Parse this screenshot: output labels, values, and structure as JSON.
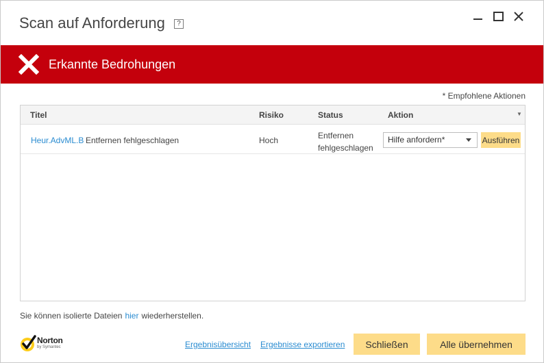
{
  "window": {
    "title": "Scan auf Anforderung",
    "help": "?"
  },
  "banner": {
    "text": "Erkannte Bedrohungen",
    "color": "#c4000c"
  },
  "note": "* Empfohlene Aktionen",
  "table": {
    "headers": {
      "title": "Titel",
      "risk": "Risiko",
      "status": "Status",
      "action": "Aktion"
    },
    "rows": [
      {
        "threat": "Heur.AdvML.B",
        "description": "Entfernen fehlgeschlagen",
        "risk": "Hoch",
        "status": "Entfernen fehlgeschlagen",
        "action": "Hilfe anfordern*",
        "run_label": "Ausführen"
      }
    ]
  },
  "restore": {
    "prefix": "Sie können isolierte Dateien",
    "link": "hier",
    "suffix": "wiederherstellen."
  },
  "footer": {
    "logo_name": "Norton",
    "logo_sub": "by Symantec",
    "summary_link": "Ergebnisübersicht",
    "export_link": "Ergebnisse exportieren",
    "close_label": "Schließen",
    "apply_label": "Alle übernehmen"
  },
  "colors": {
    "accent_button": "#fddc89",
    "link": "#2a8cd1"
  }
}
